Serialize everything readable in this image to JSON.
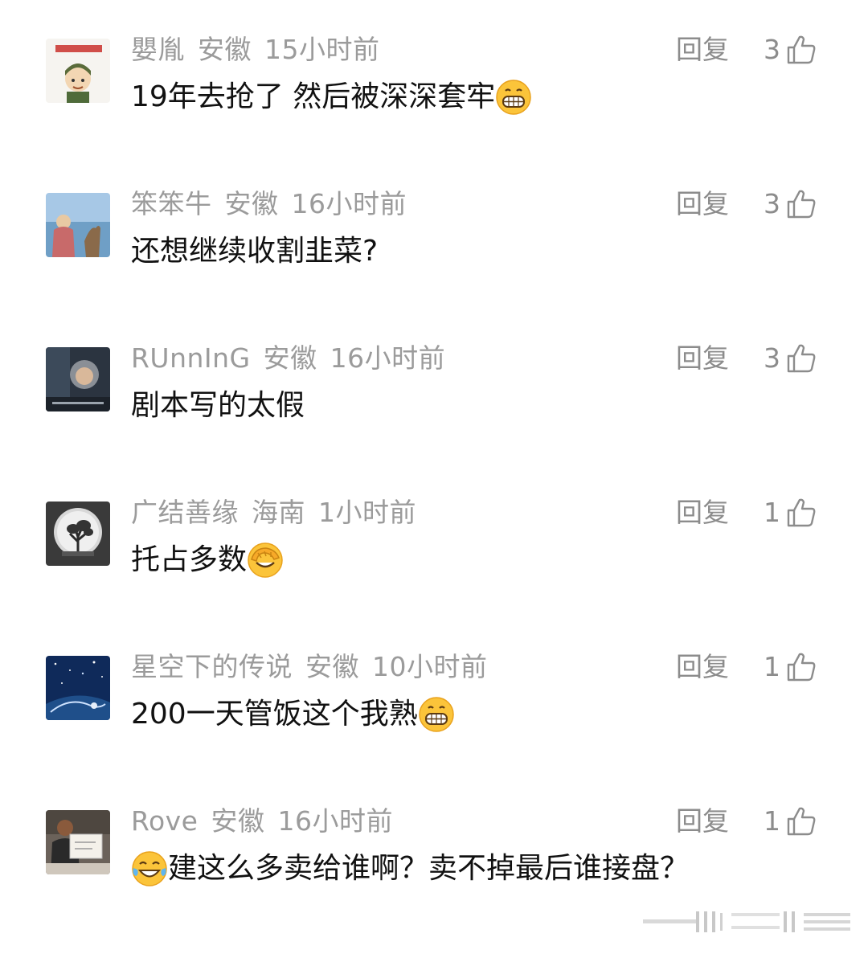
{
  "comments": [
    {
      "username": "嬰胤",
      "location": "安徽",
      "time": "15小时前",
      "text": "19年去抢了 然后被深深套牢",
      "emoji": "grin-emoji",
      "emoji_position": "after",
      "reply_label": "回复",
      "likes": "3",
      "avatar": "cartoon-avatar-with-red-text"
    },
    {
      "username": "笨笨牛",
      "location": "安徽",
      "time": "16小时前",
      "text": "还想继续收割韭菜?",
      "emoji": "",
      "emoji_position": "",
      "reply_label": "回复",
      "likes": "3",
      "avatar": "child-and-dog-by-sea-avatar"
    },
    {
      "username": "RUnnInG",
      "location": "安徽",
      "time": "16小时前",
      "text": "剧本写的太假",
      "emoji": "",
      "emoji_position": "",
      "reply_label": "回复",
      "likes": "3",
      "avatar": "movie-poster-avatar"
    },
    {
      "username": "广结善缘",
      "location": "海南",
      "time": "1小时前",
      "text": "托占多数",
      "emoji": "facepalm-emoji",
      "emoji_position": "after",
      "reply_label": "回复",
      "likes": "1",
      "avatar": "tree-in-moon-avatar"
    },
    {
      "username": "星空下的传说",
      "location": "安徽",
      "time": "10小时前",
      "text": "200一天管饭这个我熟",
      "emoji": "grin-emoji",
      "emoji_position": "after",
      "reply_label": "回复",
      "likes": "1",
      "avatar": "starry-sky-avatar"
    },
    {
      "username": "Rove",
      "location": "安徽",
      "time": "16小时前",
      "text": "建这么多卖给谁啊？卖不掉最后谁接盘？",
      "emoji": "tears-of-joy-emoji",
      "emoji_position": "before",
      "reply_label": "回复",
      "likes": "1",
      "avatar": "person-holding-sign-avatar"
    }
  ],
  "colors": {
    "meta_text": "#9b9b9b",
    "body_text": "#111111",
    "action_text": "#8c8c8c",
    "emoji_yellow": "#fbc43a"
  }
}
